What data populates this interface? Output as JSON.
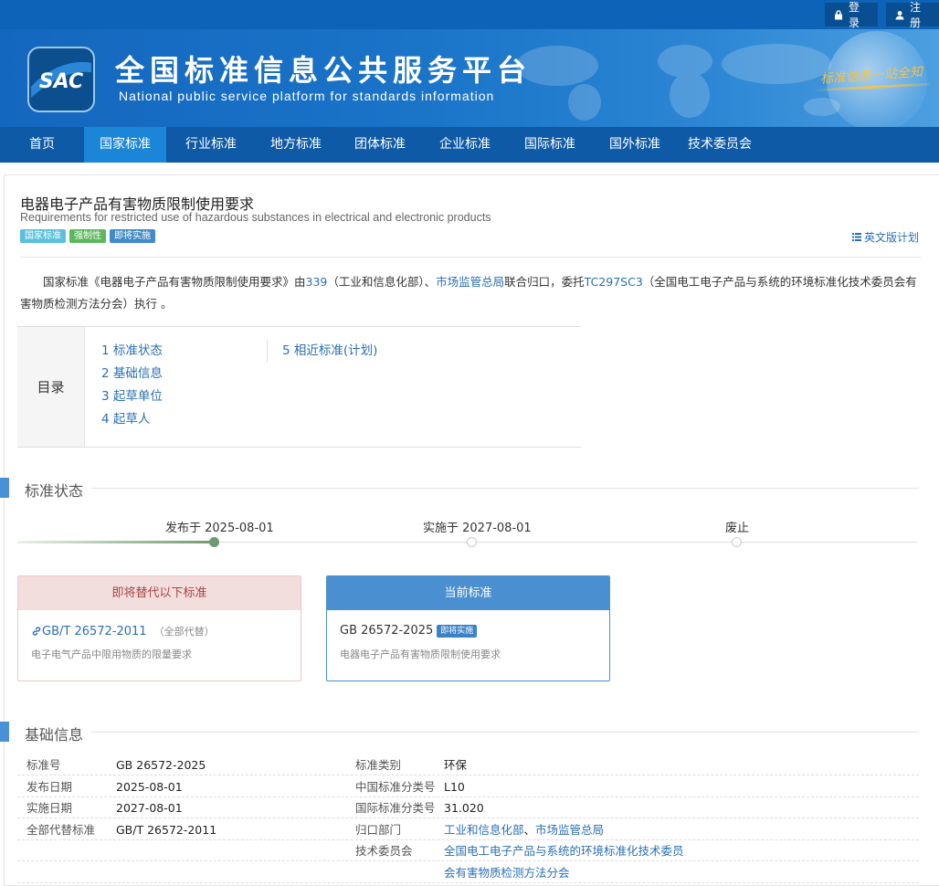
{
  "topbar": {
    "login_label": "登录",
    "register_label": "注册"
  },
  "banner": {
    "logo_text": "SAC",
    "title": "全国标准信息公共服务平台",
    "subtitle": "National public service platform  for standards information",
    "slogan": "标准信息一站全知"
  },
  "nav": {
    "items": [
      {
        "label": "首页"
      },
      {
        "label": "国家标准"
      },
      {
        "label": "行业标准"
      },
      {
        "label": "地方标准"
      },
      {
        "label": "团体标准"
      },
      {
        "label": "企业标准"
      },
      {
        "label": "国际标准"
      },
      {
        "label": "国外标准"
      },
      {
        "label": "技术委员会"
      }
    ],
    "active_index": 1
  },
  "standard": {
    "title_cn": "电器电子产品有害物质限制使用要求",
    "title_en": "Requirements for restricted use of hazardous substances in electrical and electronic products",
    "tags": [
      {
        "label": "国家标准",
        "color": "#5bc0de"
      },
      {
        "label": "强制性",
        "color": "#5cb85c"
      },
      {
        "label": "即将实施",
        "color": "#428bca"
      }
    ],
    "english_plan_label": "英文版计划"
  },
  "description": {
    "p1": "国家标准《电器电子产品有害物质限制使用要求》由",
    "link1": "339",
    "p2": "（工业和信息化部）、",
    "link2": "市场监管总局",
    "p3": "联合归口，委托",
    "link3": "TC297SC3",
    "p4": "（全国电工电子产品与系统的环境标准化技术委员会有害物质检测方法分会）执行 。"
  },
  "toc": {
    "label": "目录",
    "items": [
      "1  标准状态",
      "2  基础信息",
      "3  起草单位",
      "4  起草人",
      "5  相近标准(计划)"
    ]
  },
  "status_section": {
    "title": "标准状态"
  },
  "timeline": [
    {
      "label": "发布于 2025-08-01",
      "done": true
    },
    {
      "label": "实施于 2027-08-01",
      "done": false
    },
    {
      "label": "废止",
      "done": false
    }
  ],
  "replace_card": {
    "header": "即将替代以下标准",
    "code": "GB/T 26572-2011",
    "note": "（全部代替）",
    "name": "电子电气产品中限用物质的限量要求"
  },
  "current_card": {
    "header": "当前标准",
    "code": "GB 26572-2025",
    "badge": "即将实施",
    "name": "电器电子产品有害物质限制使用要求"
  },
  "basic_section": {
    "title": "基础信息"
  },
  "basic_info": {
    "rows": [
      {
        "k1": "标准号",
        "v1": "GB 26572-2025",
        "k2": "标准类别",
        "v2": "环保"
      },
      {
        "k1": "发布日期",
        "v1": "2025-08-01",
        "k2": "中国标准分类号",
        "v2": "L10"
      },
      {
        "k1": "实施日期",
        "v1": "2027-08-01",
        "k2": "国际标准分类号",
        "v2": "31.020"
      },
      {
        "k1": "全部代替标准",
        "v1": "GB/T 26572-2011",
        "k2": "归口部门",
        "v2a": "工业和信息化部",
        "sep": "、",
        "v2b": "市场监管总局"
      },
      {
        "k1": "",
        "v1": "",
        "k2": "技术委员会",
        "v2": "全国电工电子产品与系统的环境标准化技术委员"
      },
      {
        "k1": "",
        "v1": "",
        "k2": "",
        "v2": "会有害物质检测方法分会"
      }
    ]
  },
  "colors": {
    "brand_blue": "#0d63b8",
    "nav_active": "#1b86d8",
    "link": "#2a6fb5",
    "progress_green": "#6f9a6f"
  }
}
